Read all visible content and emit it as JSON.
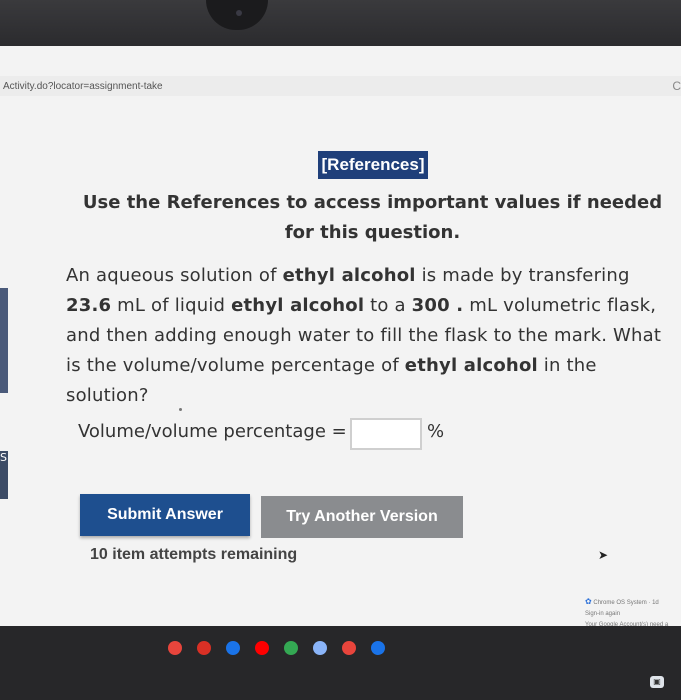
{
  "browser": {
    "url": "Activity.do?locator=assignment-take",
    "reload_icon": "C"
  },
  "sidebar": {
    "tab_label": "S"
  },
  "references_label": "[References]",
  "instruction": "Use the References to access important values if needed for this question.",
  "question": {
    "parts": [
      {
        "text": "An aqueous solution of ",
        "bold": false
      },
      {
        "text": "ethyl alcohol",
        "bold": true
      },
      {
        "text": " is made by transfering ",
        "bold": false
      },
      {
        "text": "23.6",
        "bold": true
      },
      {
        "text": " mL of liquid ",
        "bold": false
      },
      {
        "text": "ethyl alcohol",
        "bold": true
      },
      {
        "text": " to a ",
        "bold": false
      },
      {
        "text": "300 .",
        "bold": true
      },
      {
        "text": " mL volumetric flask, and then adding enough water to fill the flask to the mark. What is the volume/volume percentage of ",
        "bold": false
      },
      {
        "text": "ethyl alcohol",
        "bold": true
      },
      {
        "text": " in the solution?",
        "bold": false
      }
    ]
  },
  "answer": {
    "label": "Volume/volume percentage =",
    "value": "",
    "unit": "%"
  },
  "buttons": {
    "submit": "Submit Answer",
    "try_another": "Try Another Version"
  },
  "attempts_text": "10 item attempts remaining",
  "notification": {
    "source": "Chrome OS System",
    "time": "1d",
    "title": "Sign-in again",
    "body": "Your Google Account(s) need a"
  },
  "shelf": {
    "apps": [
      {
        "name": "chrome-icon",
        "color": "#e8453c"
      },
      {
        "name": "gmail-icon",
        "color": "#d93025"
      },
      {
        "name": "docs-icon",
        "color": "#1a73e8"
      },
      {
        "name": "youtube-icon",
        "color": "#ff0000"
      },
      {
        "name": "play-store-icon",
        "color": "#34a853"
      },
      {
        "name": "settings-icon",
        "color": "#8ab4f8"
      },
      {
        "name": "camera-app-icon",
        "color": "#e8453c"
      },
      {
        "name": "files-icon",
        "color": "#1a73e8"
      }
    ]
  }
}
